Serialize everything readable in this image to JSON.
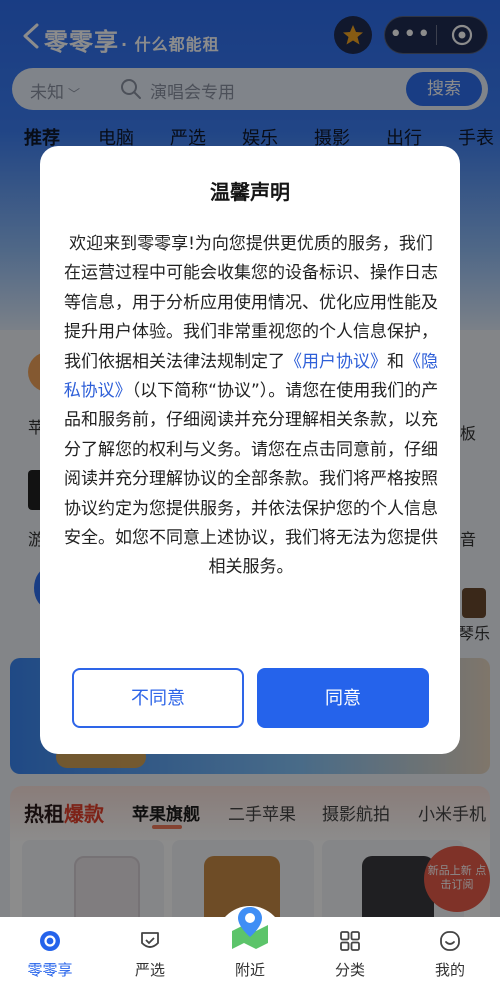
{
  "header": {
    "brand": "零零享",
    "brand_suffix": "· 什么都能租",
    "back_icon": "chevron-left-icon",
    "favorite_icon": "star-icon",
    "more_icon": "more-dots-icon",
    "close_icon": "target-icon"
  },
  "search": {
    "location": "未知",
    "placeholder": "演唱会专用",
    "button_label": "搜索"
  },
  "categories": [
    "推荐",
    "电脑",
    "严选",
    "娱乐",
    "摄影",
    "出行",
    "手表"
  ],
  "peek": {
    "left_1": "苹",
    "left_2": "游",
    "right_1": "板",
    "right_2": "音",
    "right_3": "琴乐"
  },
  "hot": {
    "title_prefix": "热租",
    "title_accent": "爆款",
    "tabs": [
      "苹果旗舰",
      "二手苹果",
      "摄影航拍",
      "小米手机"
    ],
    "new_tag": "新品上新 点击订阅"
  },
  "dialog": {
    "title": "温馨声明",
    "body_1": "欢迎来到零零享!为向您提供更优质的服务，我们在运营过程中可能会收集您的设备标识、操作日志等信息，用于分析应用使用情况、优化应用性能及提升用户体验。我们非常重视您的个人信息保护，我们依据相关法律法规制定了",
    "link_1": "《用户协议》",
    "and": "和",
    "link_2": "《隐私协议》",
    "body_2": "（以下简称“协议”）。请您在使用我们的产品和服务前，仔细阅读并充分理解相关条款，以充分了解您的权利与义务。请您在点击同意前，仔细阅读并充分理解协议的全部条款。我们将严格按照协议约定为您提供服务，并依法保护您的个人信息安全。如您不同意上述协议，我们将无法为您提供相关服务。",
    "disagree_label": "不同意",
    "agree_label": "同意"
  },
  "tabbar": {
    "items": [
      {
        "label": "零零享",
        "icon": "home-logo-icon"
      },
      {
        "label": "严选",
        "icon": "shield-check-icon"
      },
      {
        "label": "附近",
        "icon": "map-pin-icon"
      },
      {
        "label": "分类",
        "icon": "grid-icon"
      },
      {
        "label": "我的",
        "icon": "smile-icon"
      }
    ]
  },
  "colors": {
    "primary": "#2563eb",
    "header_blue": "#2f6ff0",
    "hot_accent": "#e4412c"
  }
}
